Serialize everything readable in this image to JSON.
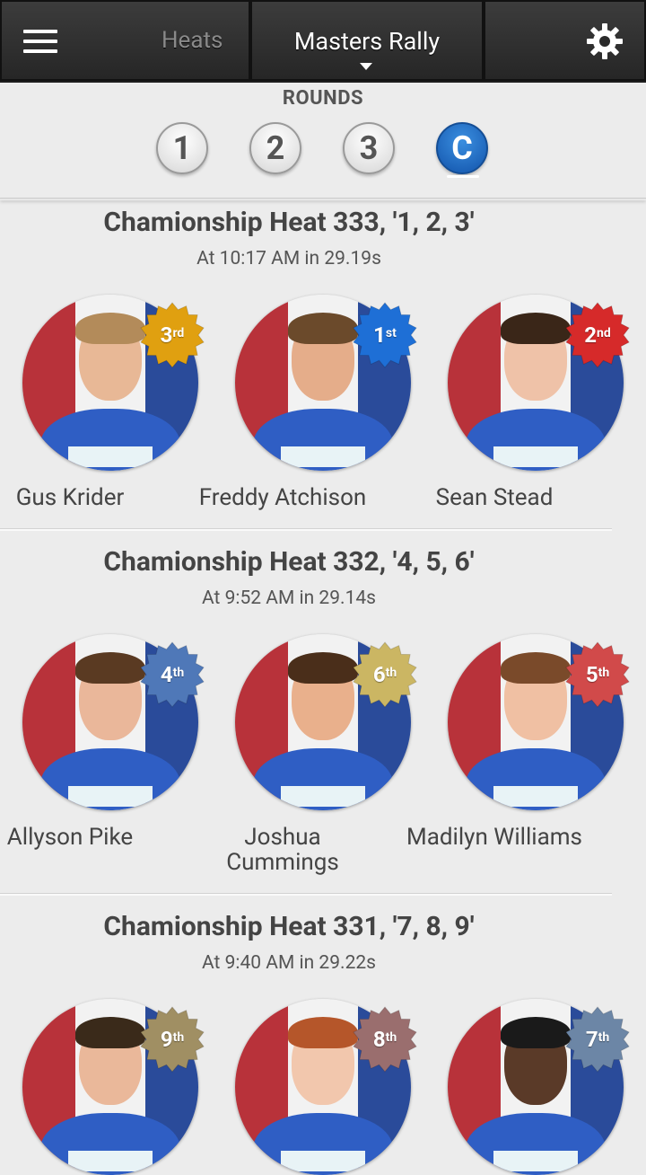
{
  "topbar": {
    "heats_label": "Heats",
    "title": "Masters Rally",
    "menu_icon": "hamburger-icon",
    "settings_icon": "gear-icon"
  },
  "rounds": {
    "title": "ROUNDS",
    "buttons": [
      "1",
      "2",
      "3",
      "C"
    ],
    "active": "C"
  },
  "colors": {
    "gold": "#e0a010",
    "blue": "#1e6fd6",
    "red": "#d62a2a",
    "steel": "#4f78b8",
    "khaki": "#cbb663",
    "rose": "#d14a4a",
    "tan": "#a08f63",
    "mauve": "#9a6e6e",
    "slate": "#6c86a6"
  },
  "heats": [
    {
      "title": "Chamionship Heat 333, '1, 2, 3'",
      "subtitle": "At 10:17 AM in 29.19s",
      "racers": [
        {
          "name": "Gus Krider",
          "place_num": "3",
          "place_suffix": "rd",
          "badge_color": "#e0a010",
          "skin": "#e8b896",
          "hair": "#b38b5a"
        },
        {
          "name": "Freddy Atchison",
          "place_num": "1",
          "place_suffix": "st",
          "badge_color": "#1e6fd6",
          "skin": "#e5ad8a",
          "hair": "#6b4a2b"
        },
        {
          "name": "Sean Stead",
          "place_num": "2",
          "place_suffix": "nd",
          "badge_color": "#d62a2a",
          "skin": "#efc2a8",
          "hair": "#3a2618"
        }
      ]
    },
    {
      "title": "Chamionship Heat 332, '4, 5, 6'",
      "subtitle": "At 9:52 AM in 29.14s",
      "racers": [
        {
          "name": "Allyson Pike",
          "place_num": "4",
          "place_suffix": "th",
          "badge_color": "#4f78b8",
          "skin": "#eab79a",
          "hair": "#5a3a22"
        },
        {
          "name": "Joshua Cummings",
          "place_num": "6",
          "place_suffix": "th",
          "badge_color": "#cbb663",
          "skin": "#e9b08c",
          "hair": "#4a2e1a"
        },
        {
          "name": "Madilyn Williams",
          "place_num": "5",
          "place_suffix": "th",
          "badge_color": "#d14a4a",
          "skin": "#f0c0a3",
          "hair": "#7a4a2a"
        }
      ]
    },
    {
      "title": "Chamionship Heat 331, '7, 8, 9'",
      "subtitle": "At 9:40 AM in 29.22s",
      "racers": [
        {
          "name": "",
          "place_num": "9",
          "place_suffix": "th",
          "badge_color": "#a08f63",
          "skin": "#eab89a",
          "hair": "#3a2a1a"
        },
        {
          "name": "",
          "place_num": "8",
          "place_suffix": "th",
          "badge_color": "#9a6e6e",
          "skin": "#f2c7ad",
          "hair": "#b5562a"
        },
        {
          "name": "",
          "place_num": "7",
          "place_suffix": "th",
          "badge_color": "#6c86a6",
          "skin": "#5a3a28",
          "hair": "#1a1a1a"
        }
      ]
    }
  ]
}
